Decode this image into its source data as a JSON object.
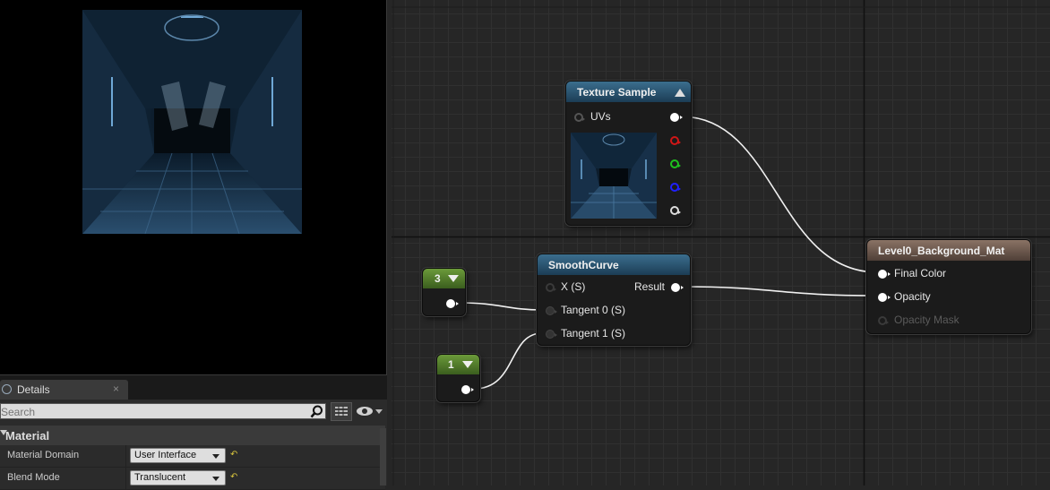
{
  "details": {
    "tab_label": "Details",
    "close_symbol": "×",
    "search_placeholder": "Search",
    "section_label": "Material",
    "properties": [
      {
        "name": "Material Domain",
        "value": "User Interface"
      },
      {
        "name": "Blend Mode",
        "value": "Translucent"
      }
    ],
    "reset_symbol": "↶"
  },
  "nodes": {
    "texture_sample": {
      "title": "Texture Sample",
      "input_label": "UVs",
      "outputs": [
        "rgb",
        "red",
        "green",
        "blue",
        "alpha"
      ]
    },
    "smooth_curve": {
      "title": "SmoothCurve",
      "inputs": [
        "X (S)",
        "Tangent 0 (S)",
        "Tangent 1 (S)"
      ],
      "output_label": "Result"
    },
    "constant_3": {
      "value": "3"
    },
    "constant_1": {
      "value": "1"
    },
    "result_node": {
      "title": "Level0_Background_Mat",
      "inputs": [
        "Final Color",
        "Opacity",
        "Opacity Mask"
      ]
    }
  },
  "colors": {
    "blue_header": "#2d5a78",
    "brown_header": "#6e5a4f",
    "green_header": "#5a8a2e",
    "wire": "#f0f0f0"
  },
  "icons": [
    "search-icon",
    "view-options-icon",
    "eye-icon",
    "details-icon",
    "close-icon",
    "reset-icon",
    "collapse-arrow-icon"
  ]
}
